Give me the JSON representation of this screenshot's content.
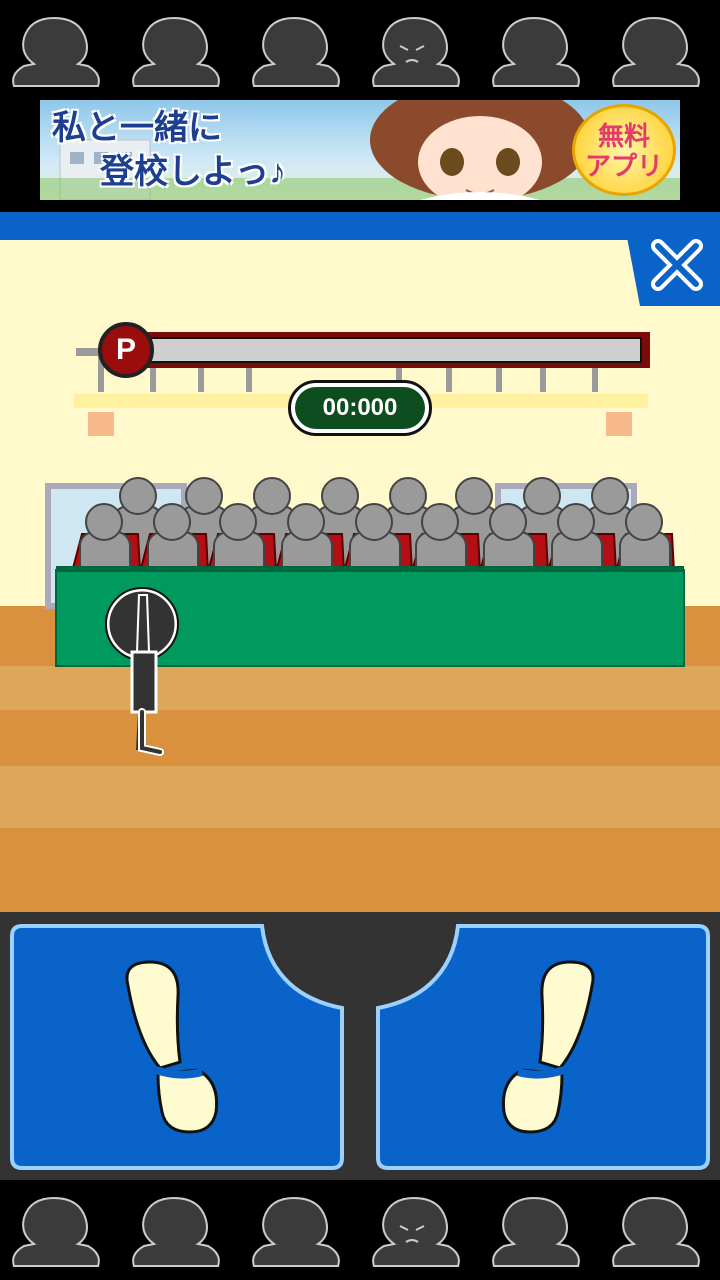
{
  "ad": {
    "headline_line1": "私と一緒に",
    "headline_line2": "登校しよっ♪",
    "badge_line1": "無料",
    "badge_line2": "アプリ"
  },
  "game": {
    "power_label": "P",
    "power_level": 0,
    "timer": "00:000"
  },
  "icons": {
    "close": "close-icon",
    "left_step": "left-footprint-icon",
    "right_step": "right-footprint-icon",
    "bowing_figure": "bowing-person-icon"
  },
  "colors": {
    "accent_blue": "#0a63c9",
    "button_blue": "#0a63c9",
    "footprint": "#fffbd0",
    "stage_wall": "#fff9cc",
    "table_green": "#009a5f",
    "floor_orange": "#d9913e"
  }
}
